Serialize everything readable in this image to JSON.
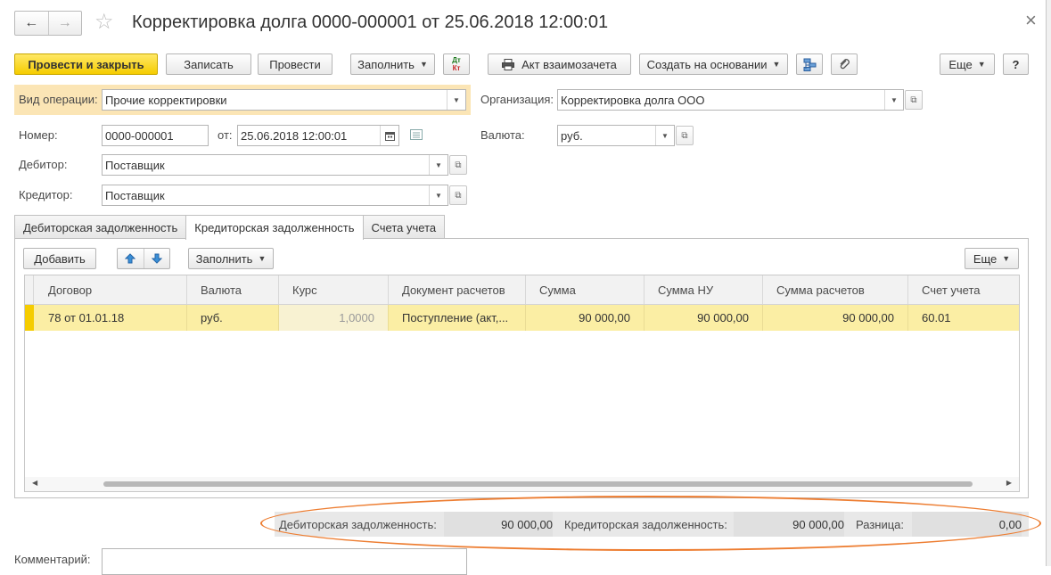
{
  "window": {
    "title": "Корректировка долга 0000-000001 от 25.06.2018 12:00:01",
    "back_icon": "←",
    "forward_icon": "→",
    "star_icon": "☆",
    "close_icon": "×"
  },
  "toolbar": {
    "post_close": "Провести и закрыть",
    "save": "Записать",
    "post": "Провести",
    "fill": "Заполнить",
    "dt_kt_top": "Дт",
    "dt_kt_bottom": "Кт",
    "act": "Акт взаимозачета",
    "create_based": "Создать на основании",
    "more": "Еще",
    "help": "?"
  },
  "form": {
    "operation_label": "Вид операции:",
    "operation_value": "Прочие корректировки",
    "org_label": "Организация:",
    "org_value": "Корректировка долга ООО",
    "number_label": "Номер:",
    "number_value": "0000-000001",
    "date_label": "от:",
    "date_value": "25.06.2018 12:00:01",
    "currency_label": "Валюта:",
    "currency_value": "руб.",
    "debtor_label": "Дебитор:",
    "debtor_value": "Поставщик",
    "creditor_label": "Кредитор:",
    "creditor_value": "Поставщик"
  },
  "tabs": [
    "Дебиторская задолженность",
    "Кредиторская задолженность",
    "Счета учета"
  ],
  "table_toolbar": {
    "add": "Добавить",
    "fill": "Заполнить",
    "more": "Еще"
  },
  "table": {
    "headers": [
      "Договор",
      "Валюта",
      "Курс",
      "Документ расчетов",
      "Сумма",
      "Сумма НУ",
      "Сумма расчетов",
      "Счет учета"
    ],
    "rows": [
      [
        "78 от 01.01.18",
        "руб.",
        "1,0000",
        "Поступление (акт,...",
        "90 000,00",
        "90 000,00",
        "90 000,00",
        "60.01"
      ]
    ]
  },
  "totals": {
    "debit_label": "Дебиторская задолженность:",
    "debit_value": "90 000,00",
    "credit_label": "Кредиторская задолженность:",
    "credit_value": "90 000,00",
    "diff_label": "Разница:",
    "diff_value": "0,00"
  },
  "comment_label": "Комментарий:",
  "colors": {
    "primary_button": "#f5cc00",
    "highlight_row": "#fbeea4",
    "operation_bar": "#fbe5b5",
    "annotation_ellipse": "#ed7d31"
  }
}
